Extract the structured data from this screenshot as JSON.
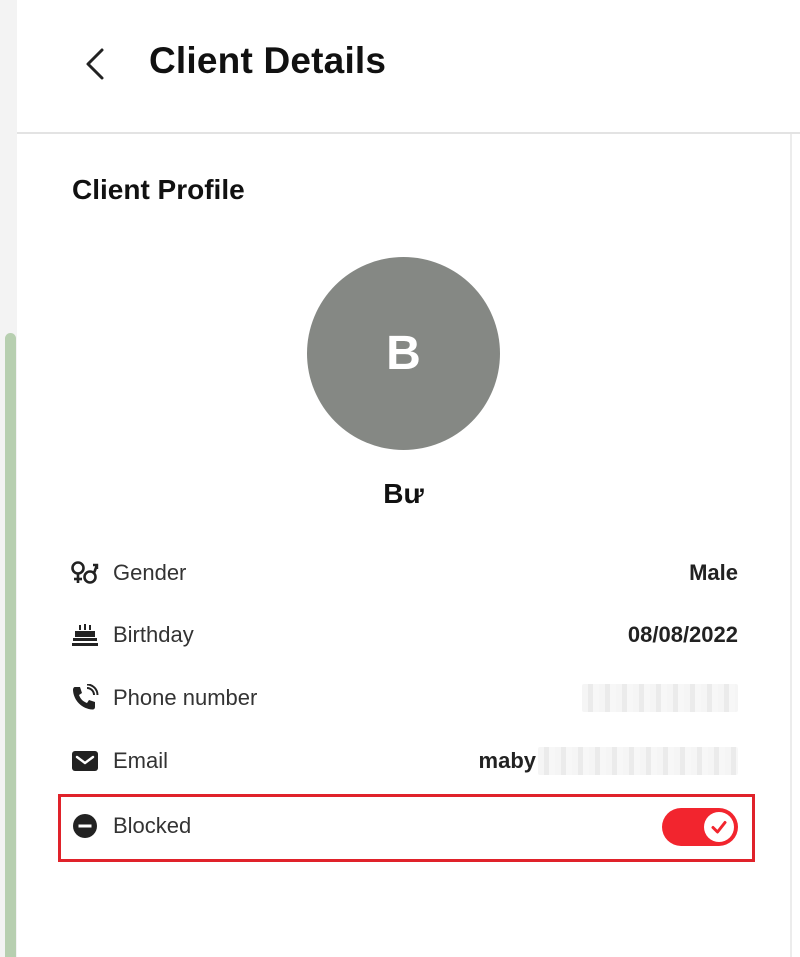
{
  "header": {
    "title": "Client Details",
    "back_icon": "chevron-left-icon"
  },
  "profile": {
    "section_title": "Client Profile",
    "avatar_initial": "B",
    "name": "Bư"
  },
  "fields": {
    "gender": {
      "label": "Gender",
      "value": "Male",
      "icon": "gender-icon"
    },
    "birthday": {
      "label": "Birthday",
      "value": "08/08/2022",
      "icon": "cake-icon"
    },
    "phone": {
      "label": "Phone number",
      "icon": "phone-icon"
    },
    "email": {
      "label": "Email",
      "value_prefix": "maby",
      "icon": "mail-icon"
    },
    "blocked": {
      "label": "Blocked",
      "icon": "minus-circle-icon",
      "enabled": true
    }
  },
  "colors": {
    "accent_red": "#f2252e",
    "highlight_border": "#e0222a",
    "avatar_bg": "#858884",
    "scroll_green": "#b7cfb0"
  }
}
